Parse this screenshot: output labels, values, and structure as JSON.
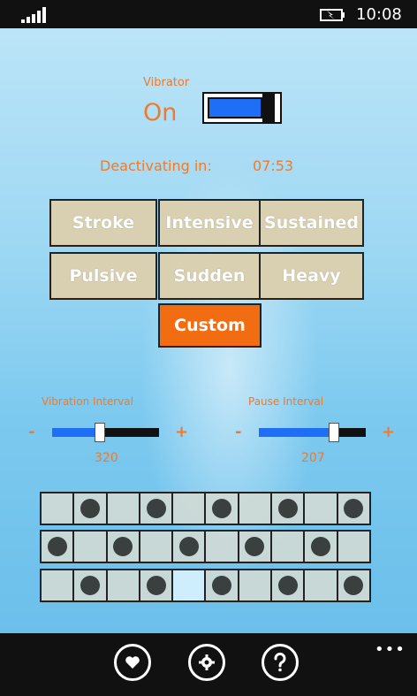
{
  "status_bar": {
    "time": "10:08",
    "signal_icon": "signal-bars-icon",
    "battery_icon": "battery-charging-icon"
  },
  "vibrator": {
    "label": "Vibrator",
    "state": "On",
    "toggle_on": true,
    "accent": "#1f6ff6"
  },
  "deactivation": {
    "label": "Deactivating in:",
    "time": "07:53"
  },
  "modes": [
    {
      "label": "Stroke"
    },
    {
      "label": "Intensive"
    },
    {
      "label": "Sustained"
    },
    {
      "label": "Pulsive"
    },
    {
      "label": "Sudden"
    },
    {
      "label": "Heavy"
    }
  ],
  "custom_button": {
    "label": "Custom",
    "color": "#f26d12"
  },
  "vibration_interval": {
    "label": "Vibration Interval",
    "minus": "-",
    "plus": "+",
    "value": "320",
    "level": 0.45
  },
  "pause_interval": {
    "label": "Pause Interval",
    "minus": "-",
    "plus": "+",
    "value": "207",
    "level": 0.7
  },
  "pattern": {
    "rows": [
      [
        0,
        1,
        0,
        1,
        0,
        1,
        0,
        1,
        0,
        1
      ],
      [
        1,
        0,
        1,
        0,
        1,
        0,
        1,
        0,
        1,
        0
      ],
      [
        0,
        1,
        0,
        1,
        0,
        1,
        0,
        1,
        0,
        1
      ]
    ],
    "highlighted": {
      "row": 2,
      "col": 4
    }
  },
  "app_bar": {
    "favorite_icon": "heart-icon",
    "settings_icon": "gear-icon",
    "help_icon": "question-icon",
    "more": "•••"
  },
  "colors": {
    "label_orange": "#ef7a2b",
    "button_beige": "#d9cfb1",
    "dot": "#3a3f3f"
  }
}
